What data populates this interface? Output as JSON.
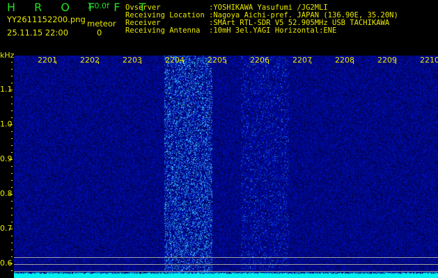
{
  "header": {
    "title": "H R O F F T",
    "version": "1.0.0f",
    "filename": "YY2611152200.png",
    "datetime": "25.11.15 22:00",
    "meteor_label": "meteor",
    "meteor_count": "0"
  },
  "info": [
    {
      "key": "Ovserver",
      "value": ":YOSHIKAWA Yasufumi /JG2MLI"
    },
    {
      "key": "Receiving Location",
      "value": ":Nagoya Aichi-pref. JAPAN (136.90E, 35.20N)"
    },
    {
      "key": "Receiver",
      "value": ":SMArt RTL-SDR V5 52.905MHz USB TACHIKAWA"
    },
    {
      "key": "Receiving Antenna",
      "value": ":10mH 3el.YAGI Horizontal:ENE"
    }
  ],
  "spectrogram": {
    "y_unit": "kHz",
    "y_ticks": [
      "1.1",
      "1.0",
      "0.9",
      "0.8",
      "0.7",
      "0.6"
    ],
    "x_ticks": [
      "2201",
      "2202",
      "2203",
      "2204",
      "2205",
      "2206",
      "2207",
      "2208",
      "2209",
      "2210"
    ],
    "colors": {
      "background": "#000000",
      "noise": "#1010c0",
      "signal": "#40d0ff",
      "baseline": "#00f0f0",
      "labels": "#e8e800"
    }
  }
}
